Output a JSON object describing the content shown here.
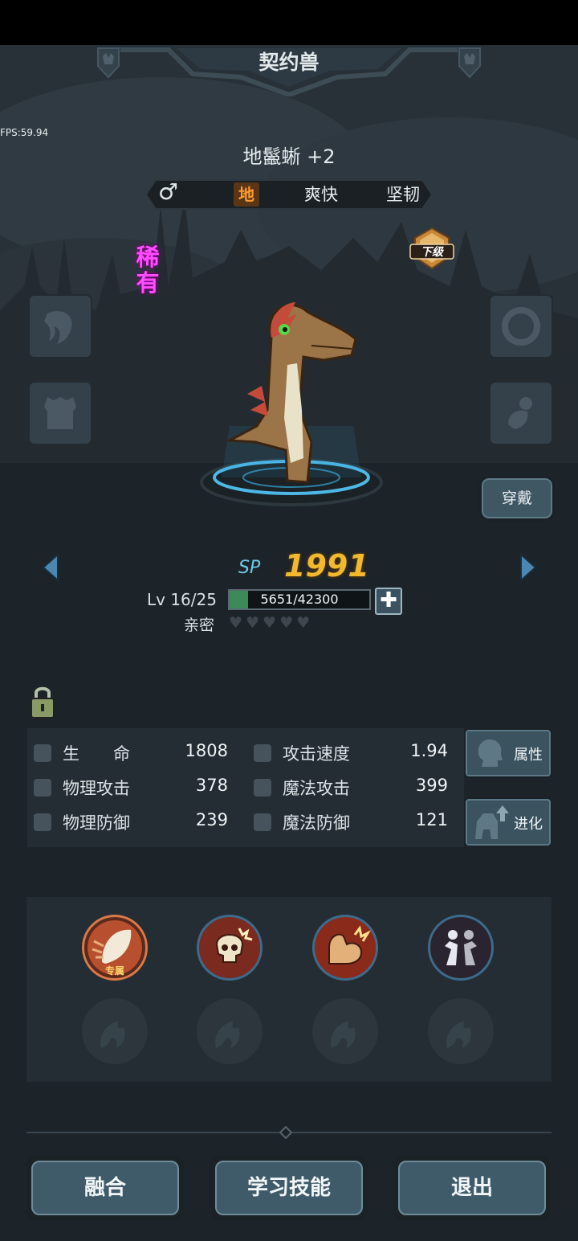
{
  "header": {
    "title": "契约兽",
    "fps": "FPS:59.94"
  },
  "pet": {
    "name": "地鬣蜥 +2",
    "gender_icon": "male-symbol-icon",
    "gender_symbol": "♂",
    "element": "地",
    "traits": [
      "爽快",
      "坚韧"
    ],
    "rarity": "稀有",
    "grade": "下级"
  },
  "equip_button": "穿戴",
  "progress": {
    "sp_label": "SP",
    "sp_value": "1991",
    "level": "Lv 16/25",
    "exp": "5651/42300",
    "exp_current": 5651,
    "exp_max": 42300,
    "plus_symbol": "✚",
    "intimacy_label": "亲密",
    "intimacy_hearts": "♥♥♥♥♥",
    "intimacy_level": 0
  },
  "stats": [
    {
      "name": "生　　命",
      "value": "1808",
      "icon": "heart-icon"
    },
    {
      "name": "物理攻击",
      "value": "378",
      "icon": "sword-icon"
    },
    {
      "name": "物理防御",
      "value": "239",
      "icon": "shield-icon"
    },
    {
      "name": "攻击速度",
      "value": "1.94",
      "icon": "boot-icon"
    },
    {
      "name": "魔法攻击",
      "value": "399",
      "icon": "staff-icon"
    },
    {
      "name": "魔法防御",
      "value": "121",
      "icon": "magic-shield-icon"
    }
  ],
  "side_buttons": {
    "attributes": "属性",
    "evolve": "进化"
  },
  "skills": {
    "exclusive_tag": "专属",
    "learned": [
      "claw-slash-icon",
      "cracked-skull-icon",
      "flexed-arm-icon",
      "twin-figures-icon"
    ],
    "empty_icon": "flame-claw-icon"
  },
  "bottom": {
    "fuse": "融合",
    "learn_skill": "学习技能",
    "exit": "退出"
  },
  "colors": {
    "background": "#1c2329",
    "panel": "#242d33",
    "sp_gold": "#f2b82e",
    "rarity_magenta": "#ff4dff",
    "element_orange": "#ff9a2e",
    "exp_green": "#3c8a57",
    "button_teal": "#3f5b69"
  }
}
